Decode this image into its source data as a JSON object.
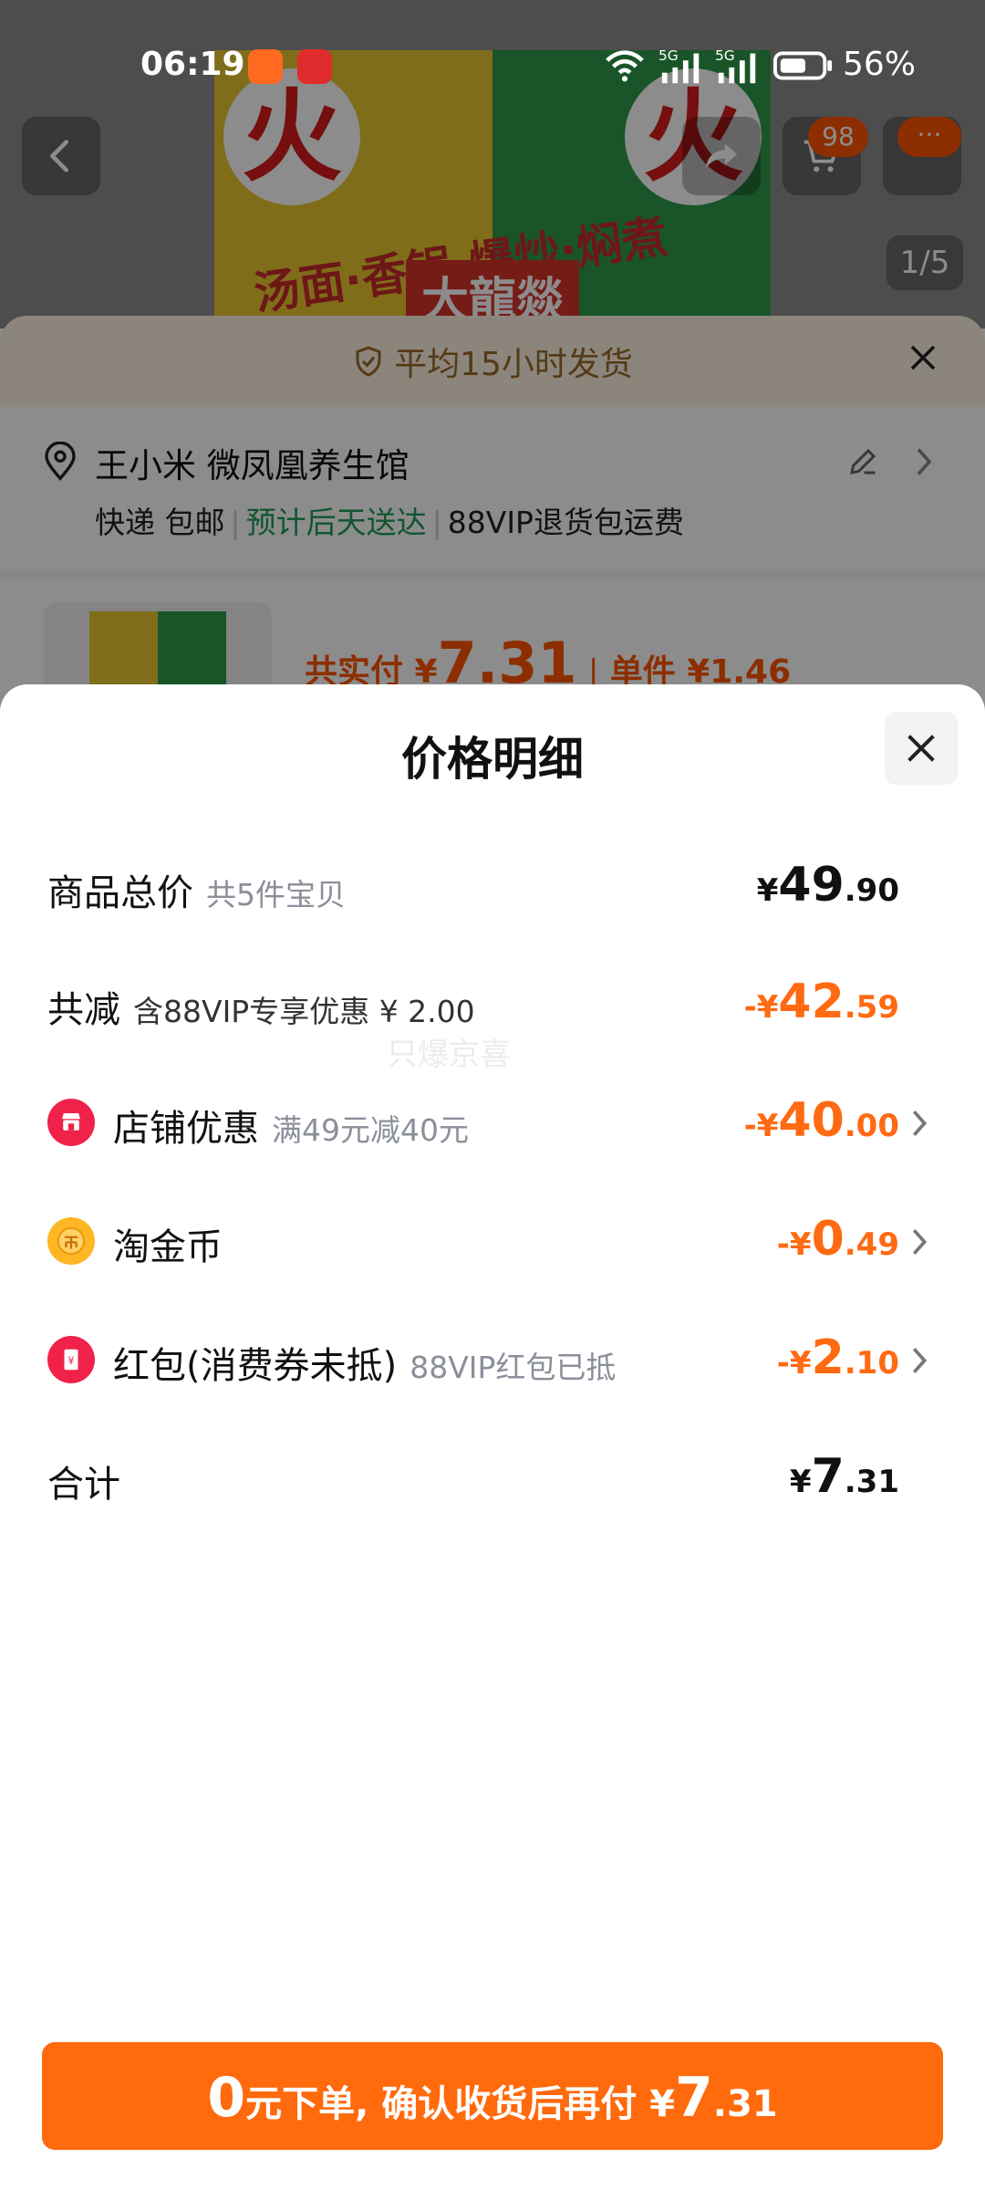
{
  "status_bar": {
    "time": "06:19",
    "battery": "56%"
  },
  "background": {
    "image_index": "1/5",
    "cart_count": "98",
    "more_label": "···",
    "hero_band_text": "汤面·香锅·爆炒·焖煮",
    "hero_logo_text": "大龍燚",
    "ship_banner": "平均15小时发货",
    "address_name": "王小米 微凤凰养生馆",
    "delivery_method": "快递 包邮",
    "delivery_eta": "预计后天送达",
    "return_info": "88VIP退货包运费",
    "total_paid_label": "共实付 ¥",
    "total_paid_value": "7.31",
    "unit_price": "单件 ¥1.46"
  },
  "modal": {
    "title": "价格明细",
    "watermark": "只爆京喜",
    "rows": [
      {
        "label": "商品总价",
        "note": "共5件宝贝",
        "currency": "¥",
        "int": "49",
        "dec": ".90"
      },
      {
        "label": "共减",
        "note": "含88VIP专享优惠 ¥ 2.00",
        "currency": "-¥",
        "int": "42",
        "dec": ".59"
      },
      {
        "label": "店铺优惠",
        "note": "满49元减40元",
        "currency": "-¥",
        "int": "40",
        "dec": ".00"
      },
      {
        "label": "淘金币",
        "note": "",
        "currency": "-¥",
        "int": "0",
        "dec": ".49"
      },
      {
        "label": "红包(消费券未抵)",
        "note": "88VIP红包已抵",
        "currency": "-¥",
        "int": "2",
        "dec": ".10"
      },
      {
        "label": "合计",
        "note": "",
        "currency": "¥",
        "int": "7",
        "dec": ".31"
      }
    ]
  },
  "cta": {
    "prefix": "0",
    "text": "元下单, 确认收货后再付 ¥",
    "int": "7",
    "dec": ".31"
  },
  "colors": {
    "accent": "#ff6a0c",
    "discount": "#ff6a12",
    "green": "#1f9b5a"
  },
  "icons": [
    "back-arrow-icon",
    "share-icon",
    "cart-icon",
    "more-icon",
    "shield-check-icon",
    "close-icon",
    "location-pin-icon",
    "edit-icon",
    "chevron-right-icon",
    "shop-icon",
    "coin-icon",
    "red-packet-icon"
  ]
}
